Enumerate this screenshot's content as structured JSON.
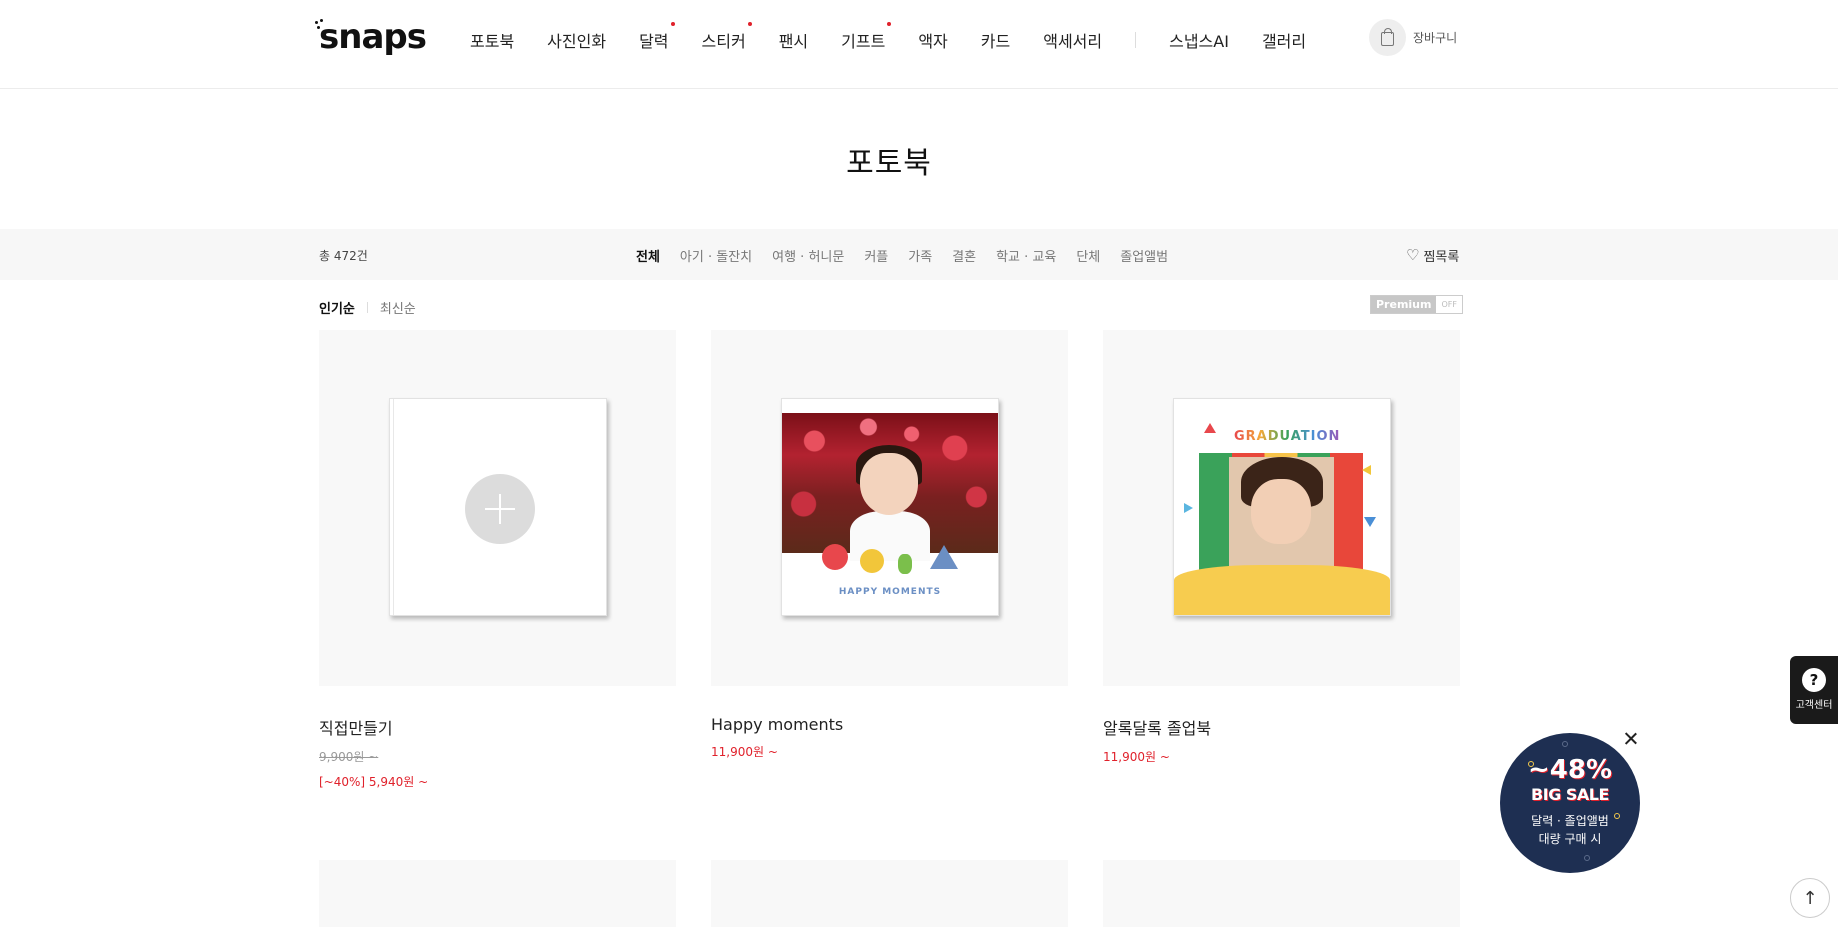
{
  "header": {
    "logo": "snaps",
    "nav": [
      {
        "label": "포토북",
        "dot": false
      },
      {
        "label": "사진인화",
        "dot": false
      },
      {
        "label": "달력",
        "dot": true
      },
      {
        "label": "스티커",
        "dot": true
      },
      {
        "label": "팬시",
        "dot": false
      },
      {
        "label": "기프트",
        "dot": true
      },
      {
        "label": "액자",
        "dot": false
      },
      {
        "label": "카드",
        "dot": false
      },
      {
        "label": "액세서리",
        "dot": false
      }
    ],
    "nav_extra": [
      {
        "label": "스냅스AI"
      },
      {
        "label": "갤러리"
      }
    ],
    "cart_label": "장바구니"
  },
  "page_title": "포토북",
  "filter": {
    "total": "총 472건",
    "categories": [
      "전체",
      "아기 · 돌잔치",
      "여행 · 허니문",
      "커플",
      "가족",
      "결혼",
      "학교 · 교육",
      "단체",
      "졸업앨범"
    ],
    "active_category": "전체",
    "wishlist": "찜목록"
  },
  "sort": {
    "popular": "인기순",
    "latest": "최신순"
  },
  "premium": {
    "label": "Premium",
    "state": "OFF"
  },
  "products": [
    {
      "name": "직접만들기",
      "price": "9,900원 ~",
      "sale": "[~40%] 5,940원 ~"
    },
    {
      "name": "Happy moments",
      "price": "11,900원 ~",
      "cover_text": "HAPPY MOMENTS"
    },
    {
      "name": "알록달록 졸업북",
      "price": "11,900원 ~",
      "cover_text": "GRADUATION"
    }
  ],
  "customer_center": "고객센터",
  "sale_badge": {
    "percent": "~48%",
    "headline": "BIG SALE",
    "line1": "달력 · 졸업앨범",
    "line2": "대량 구매 시"
  },
  "colors": {
    "accent_red": "#e0212b",
    "badge_navy": "#1e2f52"
  }
}
